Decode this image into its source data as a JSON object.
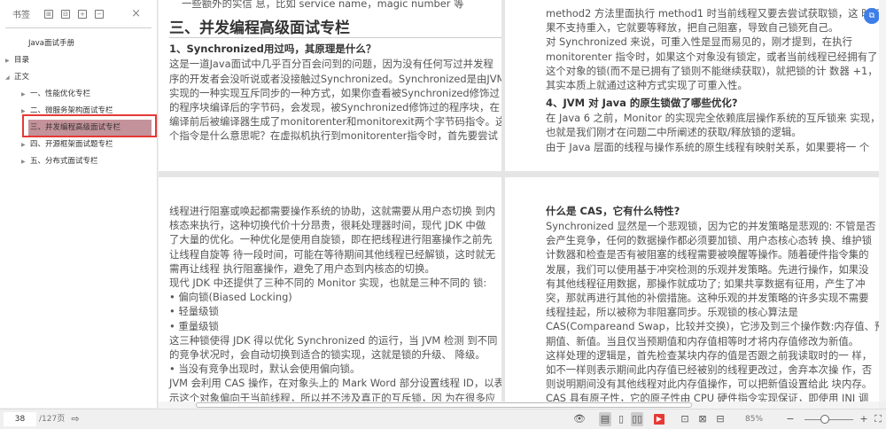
{
  "sidebar": {
    "title": "书签",
    "close": "×",
    "items": [
      {
        "label": "Java面试手册",
        "level": 0,
        "arrow": ""
      },
      {
        "label": "目录",
        "level": 0,
        "arrow": "▶"
      },
      {
        "label": "正文",
        "level": 0,
        "arrow": "◢"
      },
      {
        "label": "一、性能优化专栏",
        "level": 1,
        "arrow": "▶"
      },
      {
        "label": "二、微服务架构面试专栏",
        "level": 1,
        "arrow": "▶"
      },
      {
        "label": "三、并发编程高级面试专栏",
        "level": 1,
        "arrow": "",
        "selected": true
      },
      {
        "label": "四、开源框架面试题专栏",
        "level": 1,
        "arrow": "▶"
      },
      {
        "label": "五、分布式面试专栏",
        "level": 1,
        "arrow": "▶"
      }
    ]
  },
  "page1": {
    "top_line": "一些额外的实信 息，比如 service name，magic number 等",
    "heading": "三、并发编程高级面试专栏",
    "subheading": "1、Synchronized用过吗，其原理是什么？",
    "lines": [
      "这是一道Java面试中几乎百分百会问到的问题，因为没有任何写过并发程",
      "序的开发者会没听说或者没接触过Synchronized。Synchronized是由JVM",
      "实现的一种实现互斥同步的一种方式，如果你查看被Synchronized修饰过",
      "的程序块编译后的字节码，会发现，被Synchronized修饰过的程序块，在",
      "编译前后被编译器生成了monitorenter和monitorexit两个字节码指令。这两",
      "个指令是什么意思呢？在虚拟机执行到monitorenter指令时，首先要尝试"
    ]
  },
  "page2": {
    "lines_a": [
      "method2 方法里面执行 method1 时当前线程又要去尝试获取锁，这 时如",
      "果不支持重入，它就要等释放，把自己阻塞，导致自己锁死自己。",
      "对 Synchronized 来说，可重入性是显而易见的，刚才提到，在执行",
      "monitorenter 指令时，如果这个对象没有锁定，或者当前线程已经拥有了",
      "这个对象的锁(而不是已拥有了锁则不能继续获取)，就把锁的计 数器 +1，",
      "其实本质上就通过这种方式实现了可重入性。"
    ],
    "subheading": "4、JVM 对 Java 的原生锁做了哪些优化?",
    "lines_b": [
      "在 Java 6 之前，Monitor 的实现完全依赖底层操作系统的互斥锁来 实现，",
      "也就是我们刚才在问题二中所阐述的获取/释放锁的逻辑。",
      "由于 Java 层面的线程与操作系统的原生线程有映射关系，如果要将一 个"
    ]
  },
  "page3": {
    "lines": [
      "线程进行阻塞或唤起都需要操作系统的协助，这就需要从用户态切换 到内",
      "核态来执行，这种切换代价十分昂贵，很耗处理器时间，现代 JDK 中做",
      "了大量的优化。一种优化是使用自旋锁，即在把线程进行阻塞操作之前先",
      "让线程自旋等 待一段时间，可能在等待期间其他线程已经解锁，这时就无",
      "需再让线程 执行阻塞操作，避免了用户态到内核态的切换。",
      "现代 JDK 中还提供了三种不同的 Monitor 实现，也就是三种不同的 锁:",
      "• 偏向锁(Biased Locking)",
      "• 轻量级锁",
      "• 重量级锁",
      "这三种锁使得 JDK 得以优化 Synchronized 的运行，当 JVM 检测 到不同",
      "的竞争状况时，会自动切换到适合的锁实现，这就是锁的升级、 降级。",
      "• 当没有竞争出现时，默认会使用偏向锁。",
      "JVM 会利用 CAS 操作，在对象头上的 Mark Word 部分设置线程 ID，以表",
      "示这个对象偏向于当前线程，所以并不涉及真正的互斥锁，因 为在很多应",
      "用场景中，大部分对象生命周期中最多会被一个线程锁定，使用偏向锁可"
    ]
  },
  "page4": {
    "subheading": "什么是 CAS，它有什么特性?",
    "lines": [
      "Synchronized 显然是一个悲观锁，因为它的并发策略是悲观的: 不管是否",
      "会产生竞争，任何的数据操作都必须要加锁、用户态核心态转 换、维护锁",
      "计数器和检查是否有被阻塞的线程需要被唤醒等操作。随着硬件指令集的",
      "发展，我们可以使用基于冲突检测的乐观并发策略。先进行操作，如果没",
      "有其他线程征用数据，那操作就成功了; 如果共享数据有征用，产生了冲",
      "突，那就再进行其他的补偿措施。这种乐观的并发策略的许多实现不需要",
      "线程挂起，所以被称为非阻塞同步。乐观锁的核心算法是",
      "CAS(Compareand Swap，比较并交换)，它涉及到三个操作数:内存值、预",
      "期值、新值。当且仅当预期值和内存值相等时才将内存值修改为新值。",
      "这样处理的逻辑是，首先检查某块内存的值是否跟之前我读取时的一 样，",
      "如不一样则表示期间此内存值已经被别的线程更改过，舍弃本次操 作，否",
      "则说明期间没有其他线程对此内存值操作，可以把新值设置给此 块内存。",
      "CAS 具有原子性，它的原子性由 CPU 硬件指令实现保证，即使用 JNI 调",
      "用 Native 方法调用由 C++ 编写的硬件级别指令，JDK 中提 供了 Unsafe"
    ]
  },
  "toolbar": {
    "page_current": "38",
    "page_total": "/127页",
    "zoom": "85%",
    "minus": "−",
    "plus": "+"
  },
  "colors": {
    "selection": "#c4929a",
    "highlight_border": "#e53935",
    "accent": "#3d7ee8"
  }
}
